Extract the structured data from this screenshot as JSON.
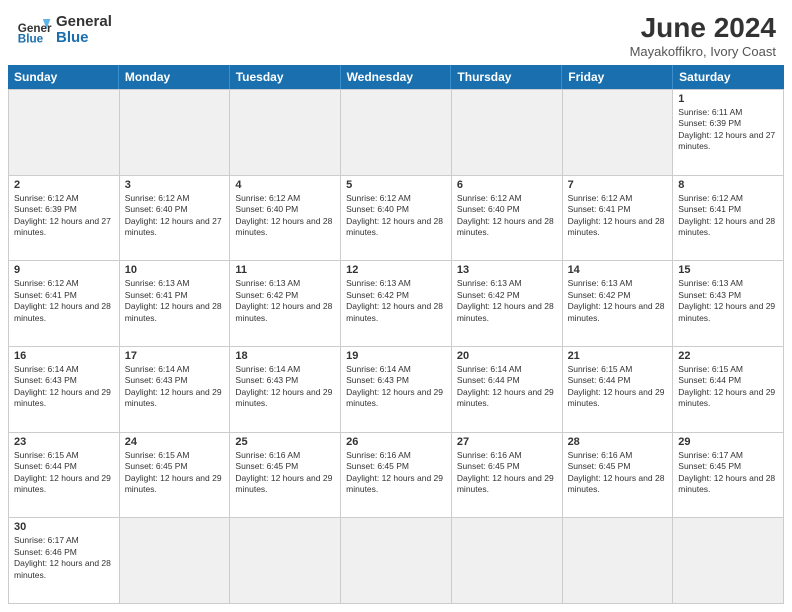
{
  "header": {
    "logo_general": "General",
    "logo_blue": "Blue",
    "month_title": "June 2024",
    "location": "Mayakoffikro, Ivory Coast"
  },
  "weekdays": [
    "Sunday",
    "Monday",
    "Tuesday",
    "Wednesday",
    "Thursday",
    "Friday",
    "Saturday"
  ],
  "weeks": [
    [
      {
        "day": "",
        "info": "",
        "empty": true
      },
      {
        "day": "",
        "info": "",
        "empty": true
      },
      {
        "day": "",
        "info": "",
        "empty": true
      },
      {
        "day": "",
        "info": "",
        "empty": true
      },
      {
        "day": "",
        "info": "",
        "empty": true
      },
      {
        "day": "",
        "info": "",
        "empty": true
      },
      {
        "day": "1",
        "info": "Sunrise: 6:11 AM\nSunset: 6:39 PM\nDaylight: 12 hours and 27 minutes.",
        "empty": false
      }
    ],
    [
      {
        "day": "2",
        "info": "Sunrise: 6:12 AM\nSunset: 6:39 PM\nDaylight: 12 hours and 27 minutes.",
        "empty": false
      },
      {
        "day": "3",
        "info": "Sunrise: 6:12 AM\nSunset: 6:40 PM\nDaylight: 12 hours and 27 minutes.",
        "empty": false
      },
      {
        "day": "4",
        "info": "Sunrise: 6:12 AM\nSunset: 6:40 PM\nDaylight: 12 hours and 28 minutes.",
        "empty": false
      },
      {
        "day": "5",
        "info": "Sunrise: 6:12 AM\nSunset: 6:40 PM\nDaylight: 12 hours and 28 minutes.",
        "empty": false
      },
      {
        "day": "6",
        "info": "Sunrise: 6:12 AM\nSunset: 6:40 PM\nDaylight: 12 hours and 28 minutes.",
        "empty": false
      },
      {
        "day": "7",
        "info": "Sunrise: 6:12 AM\nSunset: 6:41 PM\nDaylight: 12 hours and 28 minutes.",
        "empty": false
      },
      {
        "day": "8",
        "info": "Sunrise: 6:12 AM\nSunset: 6:41 PM\nDaylight: 12 hours and 28 minutes.",
        "empty": false
      }
    ],
    [
      {
        "day": "9",
        "info": "Sunrise: 6:12 AM\nSunset: 6:41 PM\nDaylight: 12 hours and 28 minutes.",
        "empty": false
      },
      {
        "day": "10",
        "info": "Sunrise: 6:13 AM\nSunset: 6:41 PM\nDaylight: 12 hours and 28 minutes.",
        "empty": false
      },
      {
        "day": "11",
        "info": "Sunrise: 6:13 AM\nSunset: 6:42 PM\nDaylight: 12 hours and 28 minutes.",
        "empty": false
      },
      {
        "day": "12",
        "info": "Sunrise: 6:13 AM\nSunset: 6:42 PM\nDaylight: 12 hours and 28 minutes.",
        "empty": false
      },
      {
        "day": "13",
        "info": "Sunrise: 6:13 AM\nSunset: 6:42 PM\nDaylight: 12 hours and 28 minutes.",
        "empty": false
      },
      {
        "day": "14",
        "info": "Sunrise: 6:13 AM\nSunset: 6:42 PM\nDaylight: 12 hours and 28 minutes.",
        "empty": false
      },
      {
        "day": "15",
        "info": "Sunrise: 6:13 AM\nSunset: 6:43 PM\nDaylight: 12 hours and 29 minutes.",
        "empty": false
      }
    ],
    [
      {
        "day": "16",
        "info": "Sunrise: 6:14 AM\nSunset: 6:43 PM\nDaylight: 12 hours and 29 minutes.",
        "empty": false
      },
      {
        "day": "17",
        "info": "Sunrise: 6:14 AM\nSunset: 6:43 PM\nDaylight: 12 hours and 29 minutes.",
        "empty": false
      },
      {
        "day": "18",
        "info": "Sunrise: 6:14 AM\nSunset: 6:43 PM\nDaylight: 12 hours and 29 minutes.",
        "empty": false
      },
      {
        "day": "19",
        "info": "Sunrise: 6:14 AM\nSunset: 6:43 PM\nDaylight: 12 hours and 29 minutes.",
        "empty": false
      },
      {
        "day": "20",
        "info": "Sunrise: 6:14 AM\nSunset: 6:44 PM\nDaylight: 12 hours and 29 minutes.",
        "empty": false
      },
      {
        "day": "21",
        "info": "Sunrise: 6:15 AM\nSunset: 6:44 PM\nDaylight: 12 hours and 29 minutes.",
        "empty": false
      },
      {
        "day": "22",
        "info": "Sunrise: 6:15 AM\nSunset: 6:44 PM\nDaylight: 12 hours and 29 minutes.",
        "empty": false
      }
    ],
    [
      {
        "day": "23",
        "info": "Sunrise: 6:15 AM\nSunset: 6:44 PM\nDaylight: 12 hours and 29 minutes.",
        "empty": false
      },
      {
        "day": "24",
        "info": "Sunrise: 6:15 AM\nSunset: 6:45 PM\nDaylight: 12 hours and 29 minutes.",
        "empty": false
      },
      {
        "day": "25",
        "info": "Sunrise: 6:16 AM\nSunset: 6:45 PM\nDaylight: 12 hours and 29 minutes.",
        "empty": false
      },
      {
        "day": "26",
        "info": "Sunrise: 6:16 AM\nSunset: 6:45 PM\nDaylight: 12 hours and 29 minutes.",
        "empty": false
      },
      {
        "day": "27",
        "info": "Sunrise: 6:16 AM\nSunset: 6:45 PM\nDaylight: 12 hours and 29 minutes.",
        "empty": false
      },
      {
        "day": "28",
        "info": "Sunrise: 6:16 AM\nSunset: 6:45 PM\nDaylight: 12 hours and 28 minutes.",
        "empty": false
      },
      {
        "day": "29",
        "info": "Sunrise: 6:17 AM\nSunset: 6:45 PM\nDaylight: 12 hours and 28 minutes.",
        "empty": false
      }
    ],
    [
      {
        "day": "30",
        "info": "Sunrise: 6:17 AM\nSunset: 6:46 PM\nDaylight: 12 hours and 28 minutes.",
        "empty": false
      },
      {
        "day": "",
        "info": "",
        "empty": true
      },
      {
        "day": "",
        "info": "",
        "empty": true
      },
      {
        "day": "",
        "info": "",
        "empty": true
      },
      {
        "day": "",
        "info": "",
        "empty": true
      },
      {
        "day": "",
        "info": "",
        "empty": true
      },
      {
        "day": "",
        "info": "",
        "empty": true
      }
    ]
  ]
}
